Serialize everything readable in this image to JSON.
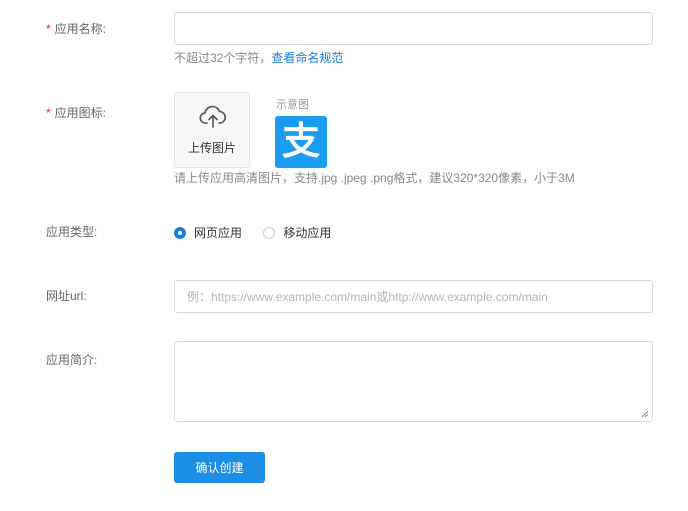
{
  "form": {
    "app_name": {
      "label": "应用名称:",
      "required_mark": "*",
      "value": "",
      "placeholder": "",
      "hint": "不超过32个字符，",
      "hint_link": "查看命名规范"
    },
    "app_icon": {
      "label": "应用图标:",
      "required_mark": "*",
      "upload_label": "上传图片",
      "sample_label": "示意图",
      "sample_glyph": "支",
      "sample_color": "#1a9cf0",
      "hint": "请上传应用高清图片，支持.jpg .jpeg .png格式，建议320*320像素，小于3M"
    },
    "app_type": {
      "label": "应用类型:",
      "options": [
        {
          "label": "网页应用",
          "selected": true
        },
        {
          "label": "移动应用",
          "selected": false
        }
      ]
    },
    "url": {
      "label": "网址url:",
      "value": "",
      "placeholder": "例：https://www.example.com/main或http://www.example.com/main"
    },
    "description": {
      "label": "应用简介:",
      "value": ""
    },
    "submit_label": "确认创建"
  },
  "colors": {
    "accent": "#1a7dde",
    "button": "#1b8ee8",
    "required": "#f5222d"
  }
}
